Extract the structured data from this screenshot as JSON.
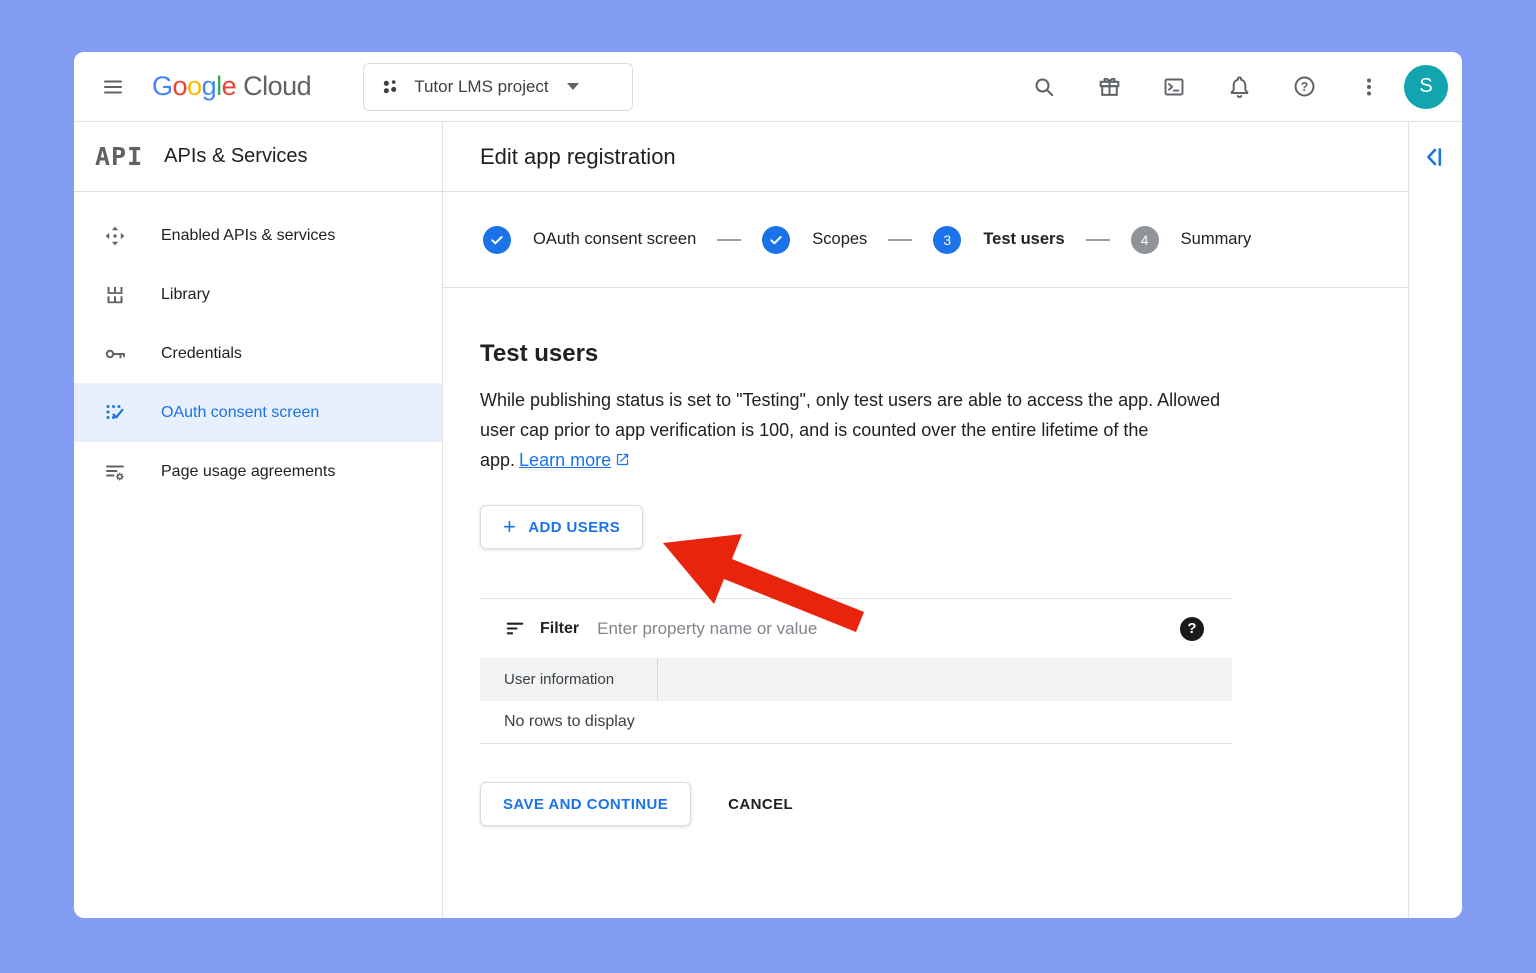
{
  "topbar": {
    "logo_letters": [
      "G",
      "o",
      "o",
      "g",
      "l",
      "e"
    ],
    "logo_cloud": "Cloud",
    "project_selector": {
      "label": "Tutor LMS project"
    },
    "avatar_initial": "S",
    "icons": [
      "menu-icon",
      "search-icon",
      "gift-icon",
      "cloud-shell-icon",
      "notifications-icon",
      "help-icon",
      "more-vert-icon"
    ]
  },
  "sidebar": {
    "logo": "API",
    "title": "APIs & Services",
    "items": [
      {
        "label": "Enabled APIs & services",
        "icon": "enabled-apis-icon",
        "active": false
      },
      {
        "label": "Library",
        "icon": "library-icon",
        "active": false
      },
      {
        "label": "Credentials",
        "icon": "key-icon",
        "active": false
      },
      {
        "label": "OAuth consent screen",
        "icon": "oauth-consent-icon",
        "active": true
      },
      {
        "label": "Page usage agreements",
        "icon": "page-agreements-icon",
        "active": false
      }
    ]
  },
  "main": {
    "page_title": "Edit app registration",
    "stepper": {
      "steps": [
        {
          "label": "OAuth consent screen",
          "state": "done"
        },
        {
          "label": "Scopes",
          "state": "done"
        },
        {
          "label": "Test users",
          "state": "active",
          "number": "3"
        },
        {
          "label": "Summary",
          "state": "upcoming",
          "number": "4"
        }
      ]
    },
    "section": {
      "heading": "Test users",
      "description": "While publishing status is set to \"Testing\", only test users are able to access the app. Allowed user cap prior to app verification is 100, and is counted over the entire lifetime of the app.",
      "learn_more_label": "Learn more",
      "plus_glyph": "+",
      "add_users_label": "ADD USERS"
    },
    "filter": {
      "label": "Filter",
      "placeholder": "Enter property name or value"
    },
    "table": {
      "column_header": "User information",
      "empty_message": "No rows to display"
    },
    "actions": {
      "save_label": "SAVE AND CONTINUE",
      "cancel_label": "CANCEL"
    }
  },
  "colors": {
    "page_background": "#849df4",
    "accent_blue": "#1a73e8",
    "active_item_background": "#e8f0fe",
    "avatar_teal": "#12a5af",
    "annotation_arrow_red": "#e8240c",
    "step_upcoming_gray": "#8f9499",
    "google_logo": [
      "#4285F4",
      "#EA4335",
      "#FBBC05",
      "#4285F4",
      "#34A853",
      "#EA4335"
    ]
  }
}
